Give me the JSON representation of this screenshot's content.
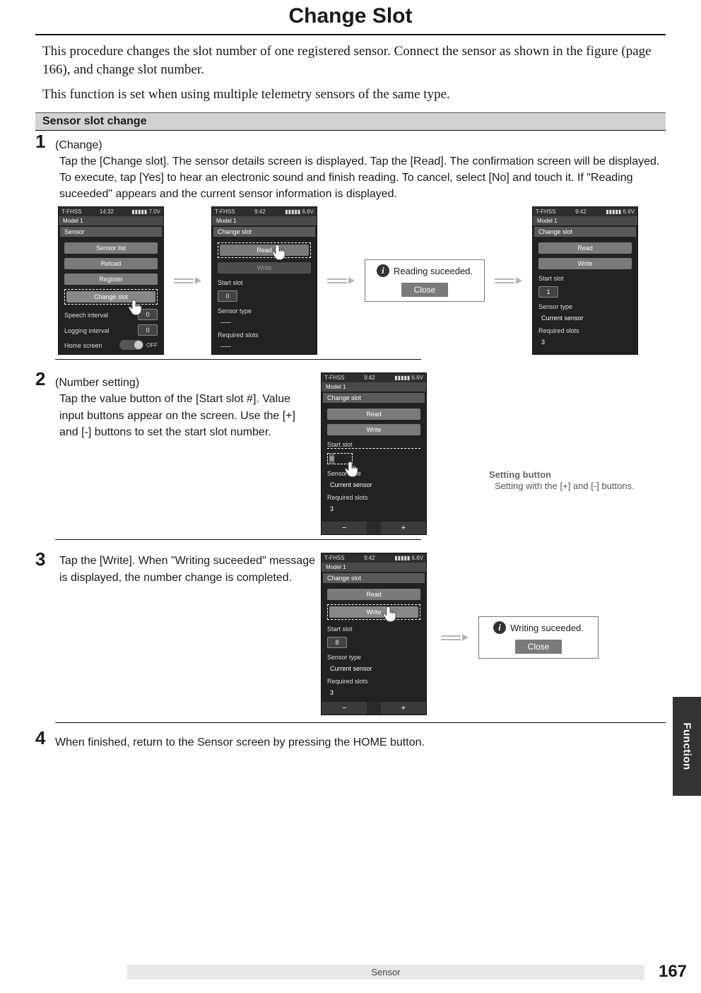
{
  "title": "Change Slot",
  "intro1": "This procedure changes the slot number of one registered sensor. Connect the sensor as shown in the figure (page 166), and change slot number.",
  "intro2": "This function is set when using multiple telemetry sensors of the same type.",
  "subheader": "Sensor slot change",
  "steps": {
    "s1": {
      "name": " (Change)",
      "body": "Tap the [Change slot]. The sensor details screen is displayed. Tap the [Read]. The confirmation screen will be displayed. To execute, tap [Yes] to hear an electronic sound and finish reading. To cancel, select [No] and touch it. If \"Reading suceeded\" appears and the current sensor information is displayed."
    },
    "s2": {
      "name": " (Number setting)",
      "body": "Tap the value button of the [Start slot #]. Value input buttons appear on the screen. Use the [+] and [-] buttons to set the start slot number."
    },
    "s3": {
      "body": "Tap the [Write]. When \"Writing suceeded\" message is displayed, the number change is completed."
    },
    "s4": {
      "body": "When finished, return to the Sensor screen by pressing the HOME button."
    }
  },
  "sidenote": {
    "head": "Setting button",
    "body": "Setting with the [+] and [-] buttons."
  },
  "screens": {
    "a": {
      "top_left": "T-FHSS",
      "time": "14:32",
      "sig": "▮▮▮▮▮",
      "batt": "7.0V",
      "subbar": "Model 1",
      "panel": "Sensor",
      "btn1": "Sensor list",
      "btn2": "Reload",
      "btn3": "Register",
      "btn4": "Change slot",
      "row1": "Speech interval",
      "row1v": "0",
      "row2": "Logging interval",
      "row2v": "0",
      "row3": "Home screen",
      "row3v": "OFF"
    },
    "b": {
      "top_left": "T-FHSS",
      "time": "9:42",
      "sig": "▮▮▮▮▮",
      "batt": "6.6V",
      "subbar": "Model 1",
      "panel": "Change slot",
      "btn1": "Read",
      "btn2": "Write",
      "l1": "Start slot",
      "v1": "0",
      "l2": "Sensor type",
      "v2": "-----",
      "l3": "Required slots",
      "v3": "-----"
    },
    "dialog1": {
      "msg": "Reading suceeded.",
      "close": "Close"
    },
    "c": {
      "top_left": "T-FHSS",
      "time": "9:42",
      "sig": "▮▮▮▮▮",
      "batt": "6.6V",
      "subbar": "Model 1",
      "panel": "Change slot",
      "btn1": "Read",
      "btn2": "Write",
      "l1": "Start slot",
      "v1": "1",
      "l2": "Sensor type",
      "v2": "Current sensor",
      "l3": "Required slots",
      "v3": "3"
    },
    "d": {
      "top_left": "T-FHSS",
      "time": "9:42",
      "sig": "▮▮▮▮▮",
      "batt": "6.6V",
      "subbar": "Model 1",
      "panel": "Change slot",
      "btn1": "Read",
      "btn2": "Write",
      "l1": "Start slot",
      "v1": "8",
      "l2": "Sensor type",
      "v2": "Current sensor",
      "l3": "Required slots",
      "v3": "3",
      "minus": "−",
      "plus": "+"
    },
    "e": {
      "top_left": "T-FHSS",
      "time": "9:42",
      "sig": "▮▮▮▮▮",
      "batt": "6.6V",
      "subbar": "Model 1",
      "panel": "Change slot",
      "btn1": "Read",
      "btn2": "Write",
      "l1": "Start slot",
      "v1": "8",
      "l2": "Sensor type",
      "v2": "Current sensor",
      "l3": "Required slots",
      "v3": "3",
      "minus": "−",
      "plus": "+"
    },
    "dialog2": {
      "msg": "Writing suceeded.",
      "close": "Close"
    }
  },
  "sidetab": "Function",
  "footer_center": "Sensor",
  "page_number": "167"
}
